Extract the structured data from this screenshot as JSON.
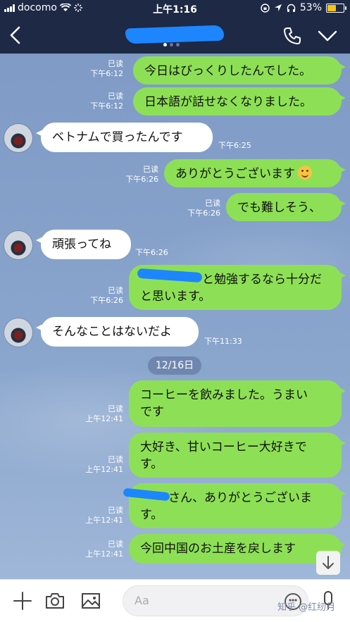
{
  "status_bar": {
    "carrier": "docomo",
    "time": "上午1:16",
    "battery": "53%",
    "battery_level": 0.53
  },
  "header": {
    "contact_name": "",
    "back_icon": "chevron-left-icon",
    "call_icon": "phone-icon",
    "menu_icon": "chevron-down-icon"
  },
  "messages": [
    {
      "dir": "out",
      "text": "今日はびっくりしたんでした。",
      "read": "已读",
      "time": "下午6:12"
    },
    {
      "dir": "out",
      "text": "日本語が話せなくなりました。",
      "read": "已读",
      "time": "下午6:12"
    },
    {
      "dir": "in",
      "text": "ベトナムで買ったんです",
      "time": "下午6:25"
    },
    {
      "dir": "out",
      "text": "ありがとうございます",
      "read": "已读",
      "time": "下午6:26"
    },
    {
      "dir": "out",
      "text": "でも難しそう、",
      "read": "已读",
      "time": "下午6:26"
    },
    {
      "dir": "in",
      "text": "頑張ってね",
      "time": "下午6:26"
    },
    {
      "dir": "out",
      "text_line1": "と勉強するなら十分だ",
      "text_line2": "と思います。",
      "read": "已读",
      "time": "下午6:26"
    },
    {
      "dir": "in",
      "text": "そんなことはないだよ",
      "time": "下午11:33"
    },
    {
      "dir": "out",
      "text_line1": "コーヒーを飲みました。うまい",
      "text_line2": "です",
      "read": "已读",
      "time": "上午12:41"
    },
    {
      "dir": "out",
      "text_line1": "大好き、甘いコーヒー大好きで",
      "text_line2": "す。",
      "read": "已读",
      "time": "上午12:41"
    },
    {
      "dir": "out",
      "text_line1": "さん、ありがとうございま",
      "text_line2": "す。",
      "read": "已读",
      "time": "上午12:41"
    },
    {
      "dir": "out",
      "text": "今回中国のお土産を戻します",
      "read": "已读",
      "time": "上午12:41"
    }
  ],
  "date_divider": "12/16日",
  "composer": {
    "placeholder": "Aa",
    "icons": [
      "plus-icon",
      "camera-icon",
      "image-icon",
      "emoji-icon",
      "microphone-icon"
    ]
  },
  "watermark": "知乎 @红纫月",
  "colors": {
    "header_bg": "#1d2945",
    "outgoing_bubble": "#8de055",
    "incoming_bubble": "#ffffff",
    "chat_bg": "#7e99c3"
  }
}
